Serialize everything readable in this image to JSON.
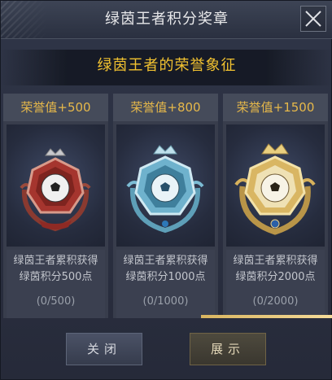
{
  "dialog": {
    "title": "绿茵王者积分奖章",
    "subtitle": "绿茵王者的荣誉象征"
  },
  "cards": [
    {
      "honor_label": "荣誉值+500",
      "desc_line1": "绿茵王者累积获得",
      "desc_line2": "绿茵积分500点",
      "progress_text": "(0/500)",
      "tier": "bronze",
      "color": "#b53a32"
    },
    {
      "honor_label": "荣誉值+800",
      "desc_line1": "绿茵王者累积获得",
      "desc_line2": "绿茵积分1000点",
      "progress_text": "(0/1000)",
      "tier": "silver",
      "color": "#7cc3dc"
    },
    {
      "honor_label": "荣誉值+1500",
      "desc_line1": "绿茵王者累积获得",
      "desc_line2": "绿茵积分2000点",
      "progress_text": "(0/2000)",
      "tier": "gold",
      "color": "#d8b25c"
    }
  ],
  "buttons": {
    "close_label": "关闭",
    "show_label": "展示"
  },
  "colors": {
    "accent_gold": "#f2c230",
    "honor_text": "#e6b84a",
    "background": "#2b3042"
  }
}
